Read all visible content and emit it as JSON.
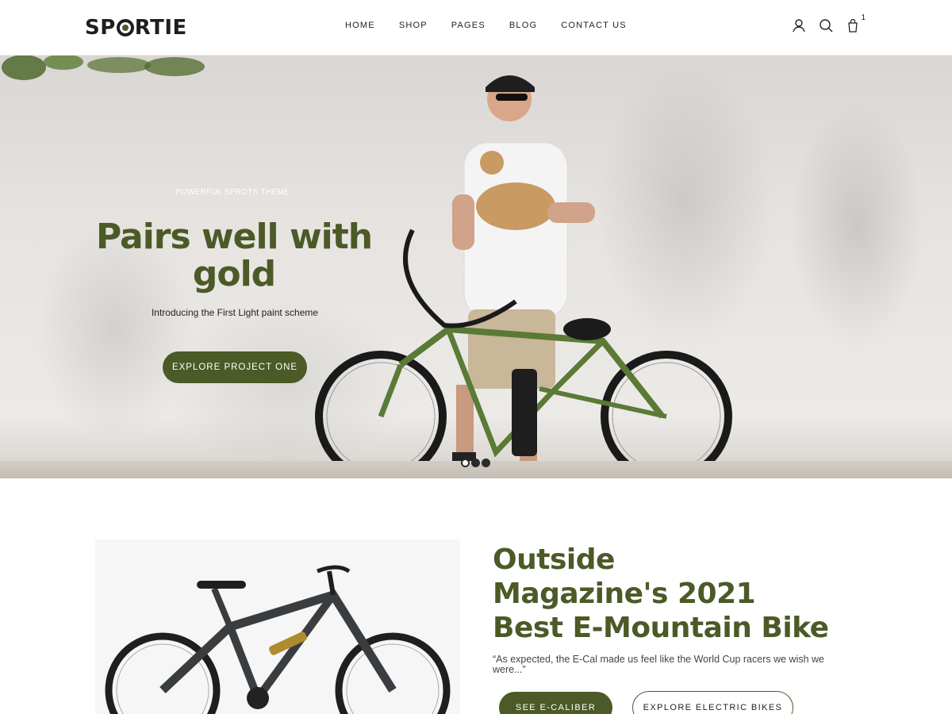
{
  "header": {
    "logo": {
      "prefix": "SP",
      "suffix": "RTIE"
    },
    "nav": [
      "HOME",
      "SHOP",
      "PAGES",
      "BLOG",
      "CONTACT US"
    ],
    "icons": [
      "user-icon",
      "search-icon",
      "bag-icon"
    ],
    "cart_count": "1"
  },
  "hero": {
    "eyebrow": "POWERFUL SPROTS THEME",
    "title": "Pairs well with gold",
    "subtitle": "Introducing the First Light paint scheme",
    "button": "EXPLORE PROJECT ONE",
    "slides": {
      "total": 3,
      "active": 1
    }
  },
  "feature": {
    "title_lines": [
      "Outside",
      "Magazine's 2021",
      "Best E-Mountain Bike"
    ],
    "quote": "“As expected, the E-Cal made us feel like the World Cup racers we wish we were...”",
    "primary_button": "SEE E-CALIBER",
    "secondary_button": "EXPLORE ELECTRIC BIKES"
  },
  "colors": {
    "accent": "#4b5a26",
    "text": "#222222",
    "background": "#ffffff"
  }
}
